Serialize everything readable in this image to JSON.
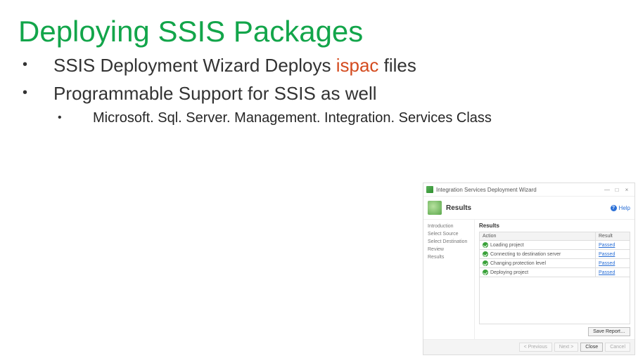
{
  "slide": {
    "title": "Deploying SSIS Packages",
    "bullets": [
      {
        "text_before": "SSIS Deployment Wizard Deploys ",
        "highlight": "ispac",
        "text_after": " files"
      },
      {
        "text": "Programmable Support for SSIS as well",
        "sub": [
          "Microsoft. Sql. Server. Management. Integration. Services Class"
        ]
      }
    ]
  },
  "wizard": {
    "window_title": "Integration Services Deployment Wizard",
    "window_buttons": {
      "min": "—",
      "max": "□",
      "close": "×"
    },
    "header": "Results",
    "help_label": "Help",
    "sidebar_steps": [
      "Introduction",
      "Select Source",
      "Select Destination",
      "Review",
      "Results"
    ],
    "results_label": "Results",
    "columns": {
      "action": "Action",
      "result": "Result"
    },
    "rows": [
      {
        "action": "Loading project",
        "result": "Passed"
      },
      {
        "action": "Connecting to destination server",
        "result": "Passed"
      },
      {
        "action": "Changing protection level",
        "result": "Passed"
      },
      {
        "action": "Deploying project",
        "result": "Passed"
      }
    ],
    "buttons": {
      "save_report": "Save Report…",
      "previous": "< Previous",
      "next": "Next >",
      "close": "Close",
      "cancel": "Cancel"
    }
  }
}
